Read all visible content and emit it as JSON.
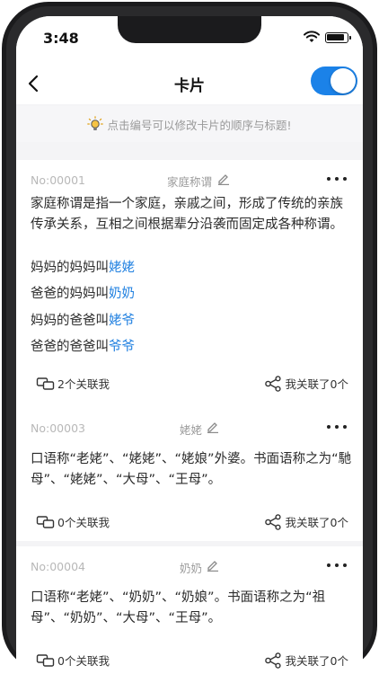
{
  "status": {
    "time": "3:48"
  },
  "nav": {
    "title": "卡片",
    "toggle_on": true
  },
  "hint": {
    "text": "点击编号可以修改卡片的顺序与标题!"
  },
  "cards": [
    {
      "id": "No:00001",
      "tag": "家庭称谓",
      "body": "家庭称谓是指一个家庭，亲戚之间，形成了传统的亲族传承关系，互相之间根据辈分沿袭而固定成各种称谓。",
      "lines": [
        {
          "prefix": "妈妈的妈妈叫",
          "highlight": "姥姥"
        },
        {
          "prefix": "爸爸的妈妈叫",
          "highlight": "奶奶"
        },
        {
          "prefix": "妈妈的爸爸叫",
          "highlight": "姥爷"
        },
        {
          "prefix": "爸爸的爸爸叫",
          "highlight": "爷爷"
        }
      ],
      "links_in": "2个关联我",
      "links_out": "我关联了0个"
    },
    {
      "id": "No:00003",
      "tag": "姥姥",
      "body": "口语称“老姥”、“姥姥”、“姥娘”外婆。书面语称之为“馳母”、“姥姥”、“大母”、“王母”。",
      "lines": [],
      "links_in": "0个关联我",
      "links_out": "我关联了0个"
    },
    {
      "id": "No:00004",
      "tag": "奶奶",
      "body": "口语称“老姥”、“奶奶”、“奶娘”。书面语称之为“祖母”、“奶奶”、“大母”、“王母”。",
      "lines": [],
      "links_in": "0个关联我",
      "links_out": "我关联了0个"
    }
  ],
  "colors": {
    "accent": "#1b82e8",
    "highlight": "#1e7fe0",
    "background": "#f4f4f6"
  },
  "icons": [
    "back-arrow-icon",
    "toggle-switch",
    "bulb-icon",
    "edit-icon",
    "more-icon",
    "link-cards-icon",
    "share-nodes-icon",
    "wifi-icon",
    "battery-icon"
  ]
}
